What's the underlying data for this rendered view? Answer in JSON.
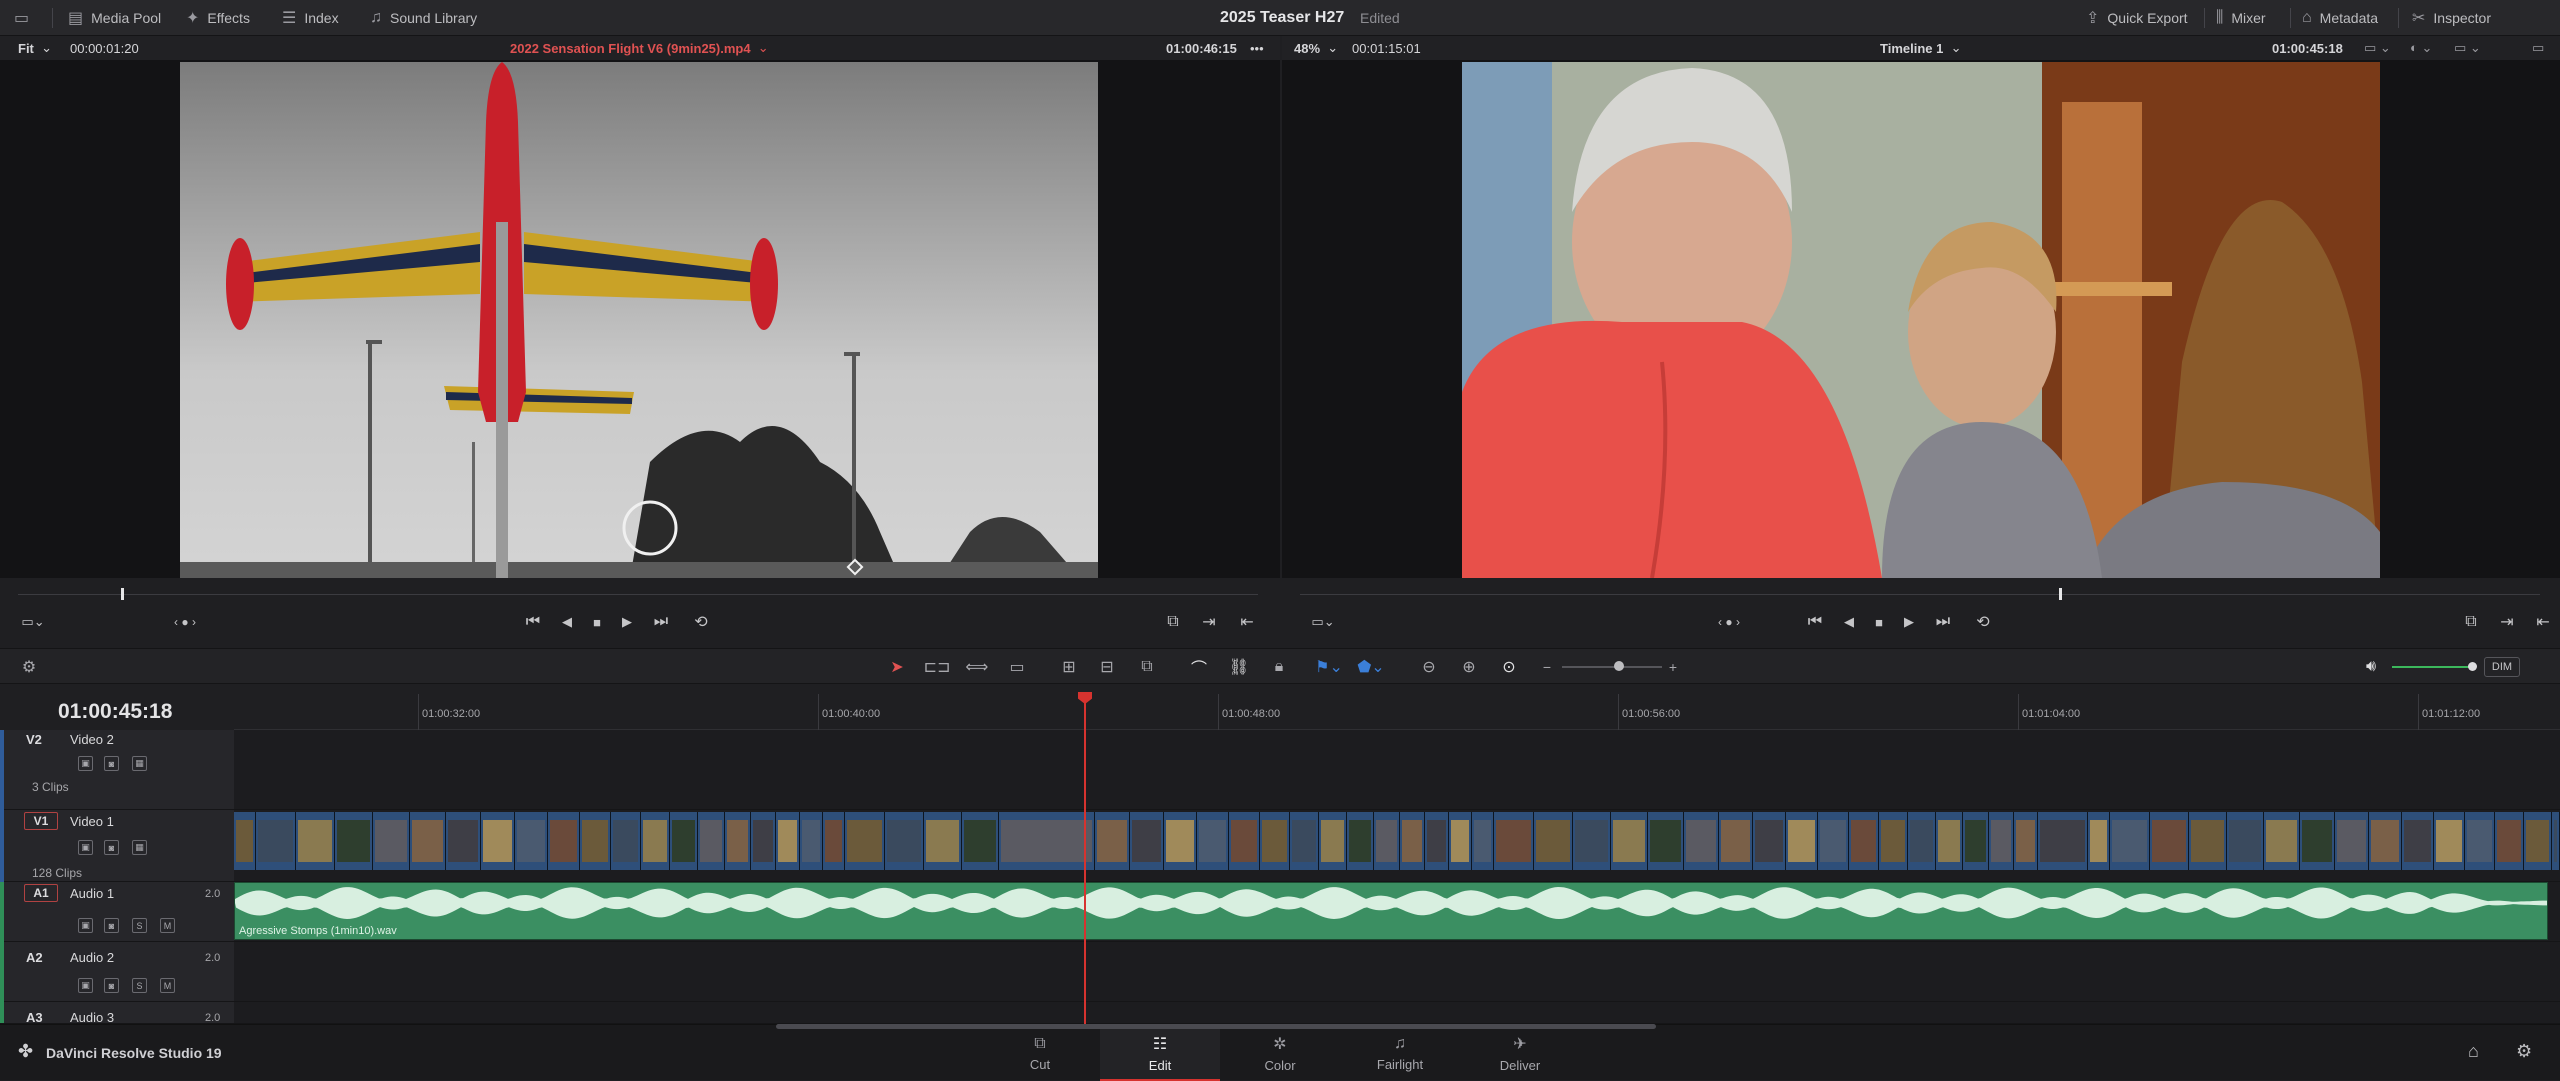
{
  "topbar": {
    "media_pool": "Media Pool",
    "effects": "Effects",
    "index": "Index",
    "sound_library": "Sound Library",
    "project_title": "2025 Teaser H27",
    "project_status": "Edited",
    "quick_export": "Quick Export",
    "mixer": "Mixer",
    "metadata": "Metadata",
    "inspector": "Inspector"
  },
  "source_viewer": {
    "zoom": "Fit",
    "duration": "00:00:01:20",
    "clip_name": "2022 Sensation Flight V6 (9min25).mp4",
    "timecode": "01:00:46:15",
    "playhead_progress": 0.083
  },
  "timeline_viewer": {
    "zoom": "48%",
    "duration": "00:01:15:01",
    "timeline_name": "Timeline 1",
    "timecode": "01:00:45:18",
    "playhead_progress": 0.612
  },
  "timeline": {
    "timecode": "01:00:45:18",
    "ruler": [
      "01:00:32:00",
      "01:00:40:00",
      "01:00:48:00",
      "01:00:56:00",
      "01:01:04:00",
      "01:01:12:00"
    ],
    "tracks": {
      "v2": {
        "id": "V2",
        "name": "Video 2",
        "clips": "3 Clips"
      },
      "v1": {
        "id": "V1",
        "name": "Video 1",
        "clips": "128 Clips"
      },
      "a1": {
        "id": "A1",
        "name": "Audio 1",
        "channels": "2.0",
        "clip_name": "Agressive Stomps (1min10).wav"
      },
      "a2": {
        "id": "A2",
        "name": "Audio 2",
        "channels": "2.0"
      },
      "a3": {
        "id": "A3",
        "name": "Audio 3",
        "channels": "2.0"
      }
    },
    "solo": "S",
    "mute": "M",
    "dim": "DIM"
  },
  "bottom": {
    "app_name": "DaVinci Resolve Studio 19",
    "pages": [
      "Cut",
      "Edit",
      "Color",
      "Fairlight",
      "Deliver"
    ],
    "active_page": "Edit"
  },
  "colors": {
    "accent_red": "#d6332f",
    "video_clip": "#2e4f7a",
    "audio_clip": "#3b8f62"
  }
}
